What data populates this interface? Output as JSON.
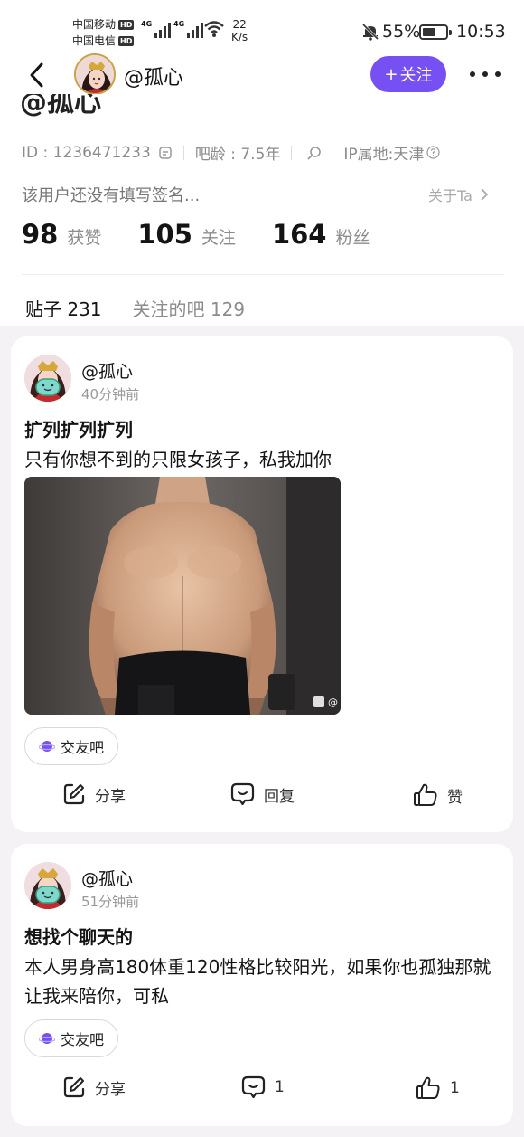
{
  "status_bar": {
    "carrier1": "中国移动",
    "carrier2": "中国电信",
    "hd": "HD",
    "net1": "4G",
    "net2": "4G",
    "speed_value": "22",
    "speed_unit": "K/s",
    "battery": "55%",
    "time": "10:53"
  },
  "nav": {
    "username": "@孤心",
    "follow_label": "关注",
    "follow_plus": "+"
  },
  "profile": {
    "display_name": "@孤心",
    "id_text": "ID : 1236471233",
    "age_text": "吧龄 : 7.5年",
    "ip_text": "IP属地:天津",
    "signature": "该用户还没有填写签名...",
    "about_label": "关于Ta",
    "stats": [
      {
        "num": "98",
        "label": "获赞"
      },
      {
        "num": "105",
        "label": "关注"
      },
      {
        "num": "164",
        "label": "粉丝"
      }
    ]
  },
  "tabs": {
    "posts": "贴子 231",
    "followed_bars": "关注的吧 129"
  },
  "posts": [
    {
      "author": "@孤心",
      "time": "40分钟前",
      "title": "扩列扩列扩列",
      "body": "只有你想不到的只限女孩子，私我加你",
      "forum": "交友吧",
      "share": "分享",
      "reply": "回复",
      "like": "赞"
    },
    {
      "author": "@孤心",
      "time": "51分钟前",
      "title": "想找个聊天的",
      "body": "本人男身高180体重120性格比较阳光，如果你也孤独那就让我来陪你，可私",
      "forum": "交友吧",
      "share": "分享",
      "reply": "1",
      "like": "1"
    }
  ],
  "colors": {
    "accent": "#7650f2",
    "background": "#f4f2f5"
  }
}
